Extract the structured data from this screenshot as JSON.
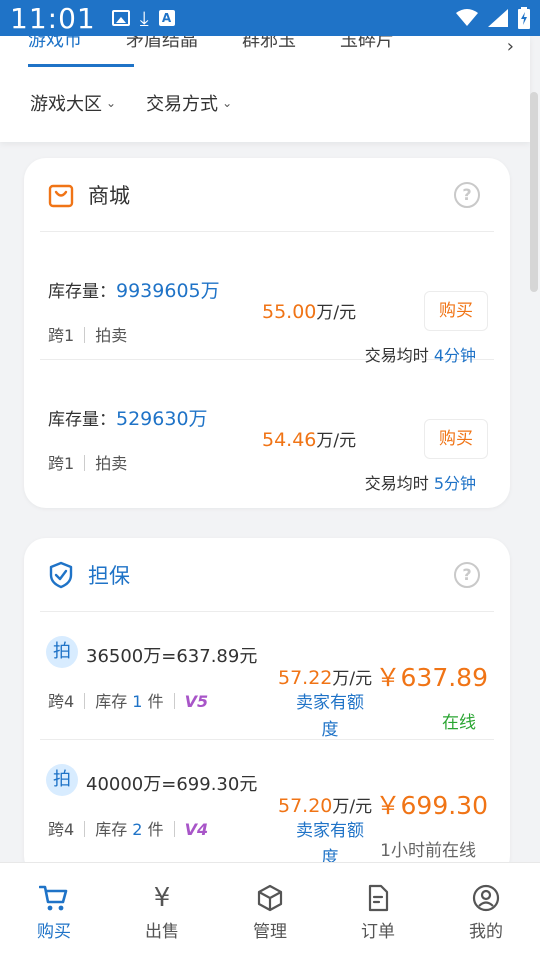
{
  "status_bar": {
    "time": "11:01"
  },
  "tabs": [
    {
      "label": "游戏币",
      "active": true
    },
    {
      "label": "矛盾结晶",
      "active": false
    },
    {
      "label": "群邪玉",
      "active": false
    },
    {
      "label": "玉碎片",
      "active": false
    }
  ],
  "filters": [
    {
      "label": "游戏大区"
    },
    {
      "label": "交易方式"
    }
  ],
  "mall": {
    "title": "商城",
    "rows": [
      {
        "stock_label": "库存量：",
        "stock": "9939605万",
        "cross": "跨1",
        "mode": "拍卖",
        "price": "55.00",
        "price_unit": "万/元",
        "buy": "购买",
        "avg_label": "交易均时",
        "avg": "4分钟"
      },
      {
        "stock_label": "库存量：",
        "stock": "529630万",
        "cross": "跨1",
        "mode": "拍卖",
        "price": "54.46",
        "price_unit": "万/元",
        "buy": "购买",
        "avg_label": "交易均时",
        "avg": "5分钟"
      }
    ]
  },
  "guarantee": {
    "title": "担保",
    "rows": [
      {
        "badge": "拍",
        "desc": "36500万=637.89元",
        "cross": "跨4",
        "stock_label": "库存",
        "stock_num": "1",
        "stock_unit": "件",
        "vip": "V5",
        "price": "57.22",
        "price_unit": "万/元",
        "quota": "卖家有额度",
        "total": "￥637.89",
        "online": "在线"
      },
      {
        "badge": "拍",
        "desc": "40000万=699.30元",
        "cross": "跨4",
        "stock_label": "库存",
        "stock_num": "2",
        "stock_unit": "件",
        "vip": "V4",
        "price": "57.20",
        "price_unit": "万/元",
        "quota": "卖家有额度",
        "total": "￥699.30",
        "online": "1小时前在线"
      }
    ]
  },
  "bottom_nav": [
    {
      "label": "购买",
      "icon": "cart-icon",
      "active": true
    },
    {
      "label": "出售",
      "icon": "yen-icon",
      "active": false
    },
    {
      "label": "管理",
      "icon": "box-icon",
      "active": false
    },
    {
      "label": "订单",
      "icon": "order-icon",
      "active": false
    },
    {
      "label": "我的",
      "icon": "user-icon",
      "active": false
    }
  ],
  "colors": {
    "primary": "#1f73c7",
    "accent": "#f07416",
    "online": "#2aa532",
    "vip": "#a855c8"
  }
}
